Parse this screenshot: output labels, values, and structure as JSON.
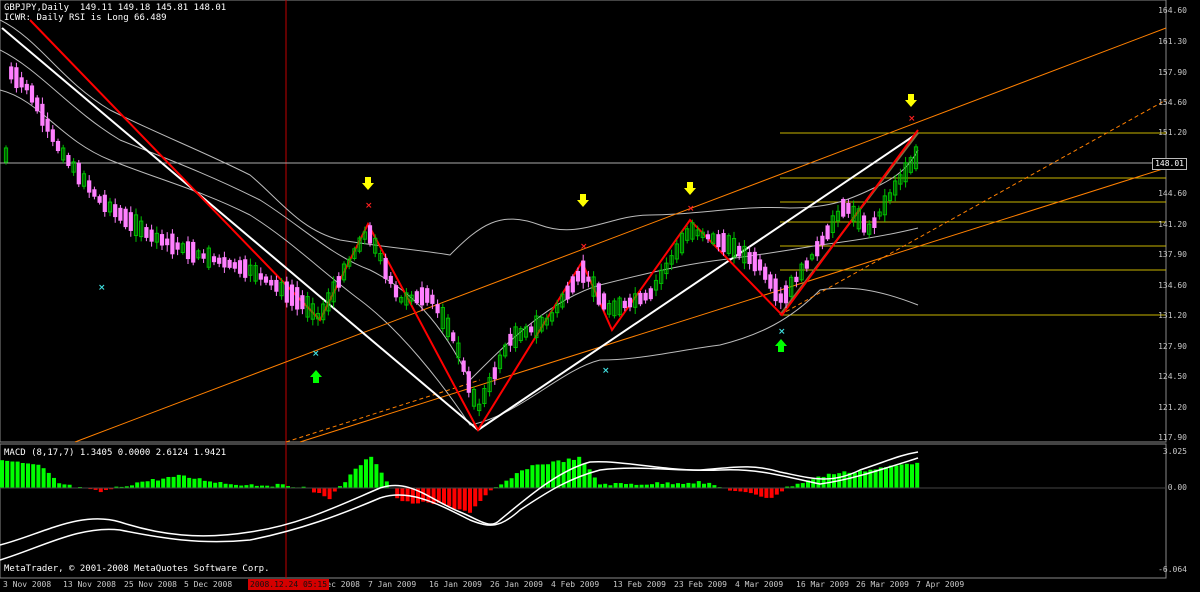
{
  "window": {
    "symbol_line": "GBPJPY,Daily  149.11 149.18 145.81 148.01",
    "indicator_line": "ICWR: Daily RSI is Long 66.489",
    "macd_label": "MACD (8,17,7) 1.3405 0.0000 2.6124 1.9421",
    "copyright": "MetaTrader, © 2001-2008 MetaQuotes Software Corp.",
    "cursor_date": "2008.12.24 05:15",
    "current_price": "148.01"
  },
  "price_axis": [
    "164.60",
    "161.30",
    "157.90",
    "154.60",
    "151.20",
    "148.01",
    "144.60",
    "141.20",
    "137.90",
    "134.60",
    "131.20",
    "127.90",
    "124.50",
    "121.20",
    "117.90"
  ],
  "macd_axis": [
    "3.025",
    "0.00",
    "-6.064"
  ],
  "time_axis": [
    "3 Nov 2008",
    "13 Nov 2008",
    "25 Nov 2008",
    "5 Dec 2008",
    "16 Dec 2008",
    "7 Jan 2009",
    "16 Jan 2009",
    "26 Jan 2009",
    "4 Feb 2009",
    "13 Feb 2009",
    "23 Feb 2009",
    "4 Mar 2009",
    "16 Mar 2009",
    "26 Mar 2009",
    "7 Apr 2009"
  ],
  "colors": {
    "background": "#000000",
    "bull_candle": "#00c000",
    "bear_candle": "#ff80ff",
    "zigzag": "#ff0000",
    "trendline": "#ffffff",
    "channel": "#ff8000",
    "fibonacci": "#c8b400",
    "bands": "#bbbbbb",
    "macd_pos": "#00ff00",
    "macd_neg": "#ff0000",
    "up_arrow": "#00ff00",
    "down_arrow": "#ffff00",
    "marker_red": "#ff2020",
    "marker_cyan": "#40e0e0"
  },
  "icons": {
    "up_arrow": "up-arrow-icon",
    "down_arrow": "down-arrow-icon",
    "cross": "cross-marker-icon"
  }
}
